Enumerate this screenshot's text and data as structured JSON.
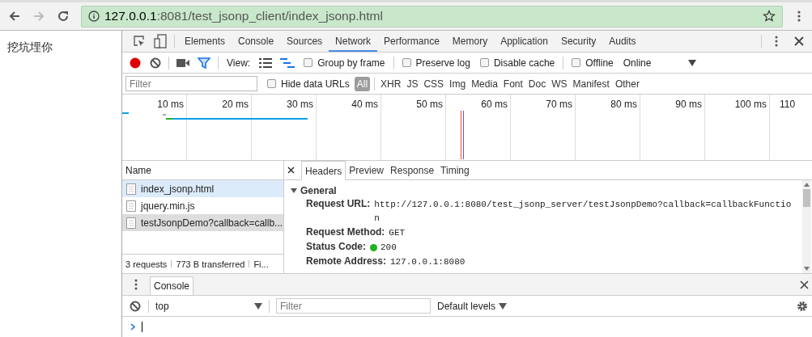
{
  "address_bar": {
    "host": "127.0.0.1",
    "path": ":8081/test_jsonp_client/index_jsonp.html"
  },
  "page": {
    "text": "挖坑埋你"
  },
  "devtools_tabs": [
    {
      "label": "Elements",
      "selected": false
    },
    {
      "label": "Console",
      "selected": false
    },
    {
      "label": "Sources",
      "selected": false
    },
    {
      "label": "Network",
      "selected": true
    },
    {
      "label": "Performance",
      "selected": false
    },
    {
      "label": "Memory",
      "selected": false
    },
    {
      "label": "Application",
      "selected": false
    },
    {
      "label": "Security",
      "selected": false
    },
    {
      "label": "Audits",
      "selected": false
    }
  ],
  "toolbar": {
    "recording": true,
    "view_label": "View:",
    "checks": [
      {
        "label": "Group by frame",
        "checked": false
      },
      {
        "label": "Preserve log",
        "checked": false
      },
      {
        "label": "Disable cache",
        "checked": false
      },
      {
        "label": "Offline",
        "checked": false
      }
    ],
    "throttling": "Online"
  },
  "filter_bar": {
    "placeholder": "Filter",
    "hide_data_urls": {
      "label": "Hide data URLs",
      "checked": false
    },
    "types": [
      {
        "label": "All",
        "selected": true
      },
      {
        "label": "XHR",
        "selected": false
      },
      {
        "label": "JS",
        "selected": false
      },
      {
        "label": "CSS",
        "selected": false
      },
      {
        "label": "Img",
        "selected": false
      },
      {
        "label": "Media",
        "selected": false
      },
      {
        "label": "Font",
        "selected": false
      },
      {
        "label": "Doc",
        "selected": false
      },
      {
        "label": "WS",
        "selected": false
      },
      {
        "label": "Manifest",
        "selected": false
      },
      {
        "label": "Other",
        "selected": false
      }
    ]
  },
  "timeline": {
    "ticks": [
      "10 ms",
      "20 ms",
      "30 ms",
      "40 ms",
      "50 ms",
      "60 ms",
      "70 ms",
      "80 ms",
      "90 ms",
      "100 ms",
      "110"
    ]
  },
  "requests": {
    "column": "Name",
    "rows": [
      {
        "name": "index_jsonp.html",
        "selected": true,
        "hovered": false
      },
      {
        "name": "jquery.min.js",
        "selected": false,
        "hovered": false
      },
      {
        "name": "testJsonpDemo?callback=callb...",
        "selected": false,
        "hovered": true
      }
    ],
    "summary": [
      "3 requests",
      "773 B transferred",
      "Fi..."
    ]
  },
  "details": {
    "tabs": [
      {
        "label": "Headers",
        "selected": true
      },
      {
        "label": "Preview",
        "selected": false
      },
      {
        "label": "Response",
        "selected": false
      },
      {
        "label": "Timing",
        "selected": false
      }
    ],
    "section": {
      "title": "General",
      "expanded": true
    },
    "fields": [
      {
        "key": "Request URL:",
        "value": "http://127.0.0.1:8080/test_jsonp_server/testJsonpDemo?callback=callbackFunction"
      },
      {
        "key": "Request Method:",
        "value": "GET"
      },
      {
        "key": "Status Code:",
        "value": "200",
        "color": "#1fb31f"
      },
      {
        "key": "Remote Address:",
        "value": "127.0.0.1:8080"
      }
    ]
  },
  "drawer": {
    "tabs": [
      {
        "label": "Console",
        "selected": true
      }
    ],
    "context": "top",
    "filter_placeholder": "Filter",
    "levels": "Default levels"
  }
}
